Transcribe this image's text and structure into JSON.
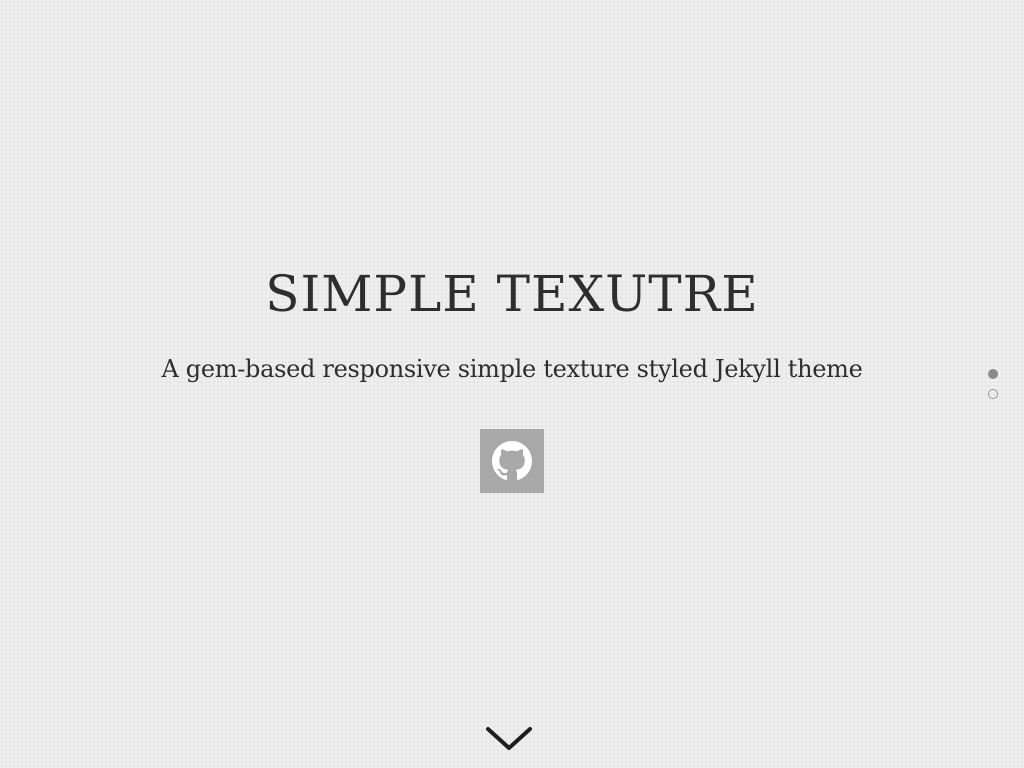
{
  "hero": {
    "title": "SIMPLE TEXUTRE",
    "tagline": "A gem-based responsive simple texture styled Jekyll theme"
  },
  "social": [
    {
      "icon": "github-icon",
      "label": "GitHub"
    }
  ],
  "pagination": {
    "sections": 2,
    "active_index": 0
  },
  "scroll": {
    "icon": "chevron-down-icon"
  },
  "colors": {
    "background": "#ececec",
    "text": "#2e2e2e",
    "social_button": "#a8a8a8",
    "dot": "#8a8a8a"
  }
}
